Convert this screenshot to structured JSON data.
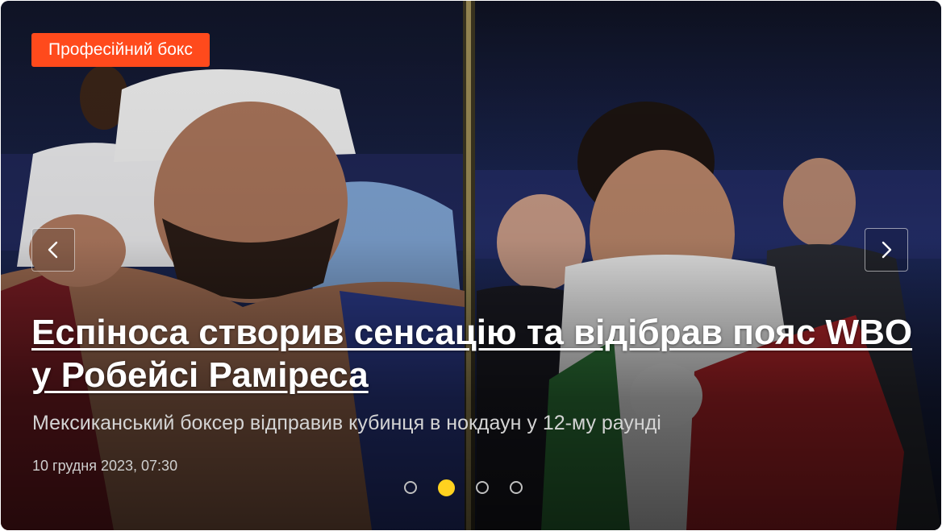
{
  "slide": {
    "category": "Професійний бокс",
    "headline": "Еспіноса створив сенсацію та відібрав пояс WBO у Робейсі Раміреса",
    "subtitle": "Мексиканський боксер відправив кубинця в нокдаун у 12-му раунді",
    "date": "10 грудня 2023, 07:30"
  },
  "carousel": {
    "prev_icon": "chevron-left-icon",
    "next_icon": "chevron-right-icon",
    "slide_count": 4,
    "active_index": 1
  },
  "colors": {
    "category_bg": "#ff4a1c",
    "active_dot": "#ffd21f"
  }
}
